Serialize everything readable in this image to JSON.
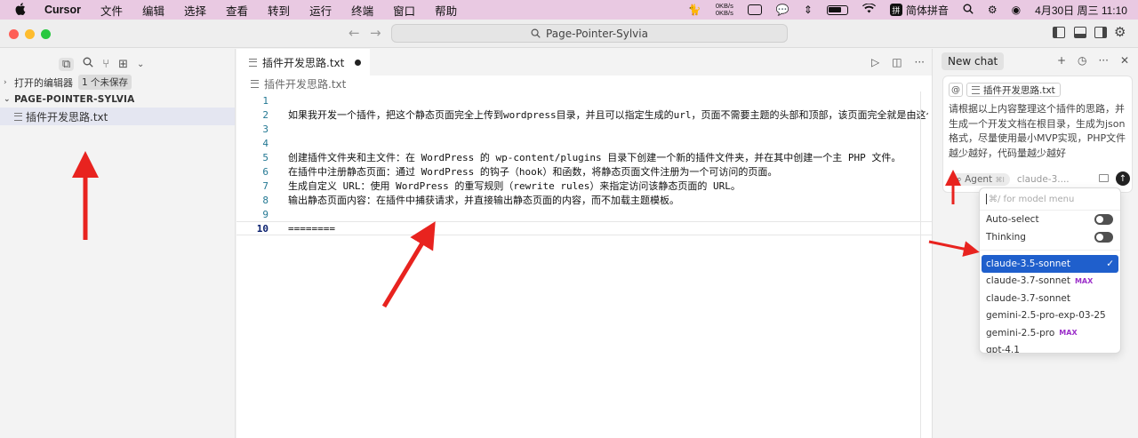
{
  "menubar": {
    "apple": "",
    "app": "Cursor",
    "items": [
      "文件",
      "编辑",
      "选择",
      "查看",
      "转到",
      "运行",
      "终端",
      "窗口",
      "帮助"
    ],
    "net_up": "0KB/s",
    "net_down": "0KB/s",
    "ime": "简体拼音",
    "ime_badge": "拼",
    "datetime": "4月30日 周三  11:10"
  },
  "titlebar": {
    "search": "Page-Pointer-Sylvia"
  },
  "sidebar": {
    "open_editors": "打开的编辑器",
    "unsaved_badge": "1 个未保存",
    "folder": "PAGE-POINTER-SYLVIA",
    "file": "插件开发思路.txt"
  },
  "editor": {
    "tab": "插件开发思路.txt",
    "breadcrumb": "插件开发思路.txt",
    "lines": [
      {
        "n": "1",
        "t": ""
      },
      {
        "n": "2",
        "t": "如果我开发一个插件，把这个静态页面完全上传到wordpress目录，并且可以指定生成的url，页面不需要主题的头部和顶部，该页面完全就是由这个单页"
      },
      {
        "n": "3",
        "t": ""
      },
      {
        "n": "4",
        "t": ""
      },
      {
        "n": "5",
        "t": "创建插件文件夹和主文件：在 WordPress 的 wp-content/plugins 目录下创建一个新的插件文件夹，并在其中创建一个主 PHP 文件。"
      },
      {
        "n": "6",
        "t": "在插件中注册静态页面：通过 WordPress 的钩子（hook）和函数，将静态页面文件注册为一个可访问的页面。"
      },
      {
        "n": "7",
        "t": "生成自定义 URL：使用 WordPress 的重写规则（rewrite rules）来指定访问该静态页面的 URL。"
      },
      {
        "n": "8",
        "t": "输出静态页面内容：在插件中捕获请求，并直接输出静态页面的内容，而不加载主题模板。"
      },
      {
        "n": "9",
        "t": ""
      },
      {
        "n": "10",
        "t": "========"
      }
    ]
  },
  "chat": {
    "tab": "New chat",
    "at": "@",
    "context_file": "插件开发思路.txt",
    "prompt": "请根据以上内容整理这个插件的思路，并生成一个开发文档在根目录，生成为json格式，尽量使用最小MVP实现，PHP文件越少越好，代码量越少越好",
    "mode": "Agent",
    "mode_shortcut": "⌘I",
    "model_short": "claude-3....",
    "model_menu": {
      "search_placeholder": "⌘/ for model menu",
      "auto_select": "Auto-select",
      "thinking": "Thinking",
      "models": [
        {
          "name": "claude-3.5-sonnet",
          "max": "",
          "selected": true
        },
        {
          "name": "claude-3.7-sonnet",
          "max": "MAX",
          "selected": false
        },
        {
          "name": "claude-3.7-sonnet",
          "max": "",
          "selected": false
        },
        {
          "name": "gemini-2.5-pro-exp-03-25",
          "max": "",
          "selected": false
        },
        {
          "name": "gemini-2.5-pro",
          "max": "MAX",
          "selected": false
        },
        {
          "name": "gpt-4.1",
          "max": "",
          "selected": false
        }
      ],
      "check": "✓"
    }
  },
  "colors": {
    "menubar_bg": "#e9c9e2",
    "selection_blue": "#1f5fcc",
    "max_purple": "#9b2fc9",
    "annotation_red": "#e8231f"
  }
}
